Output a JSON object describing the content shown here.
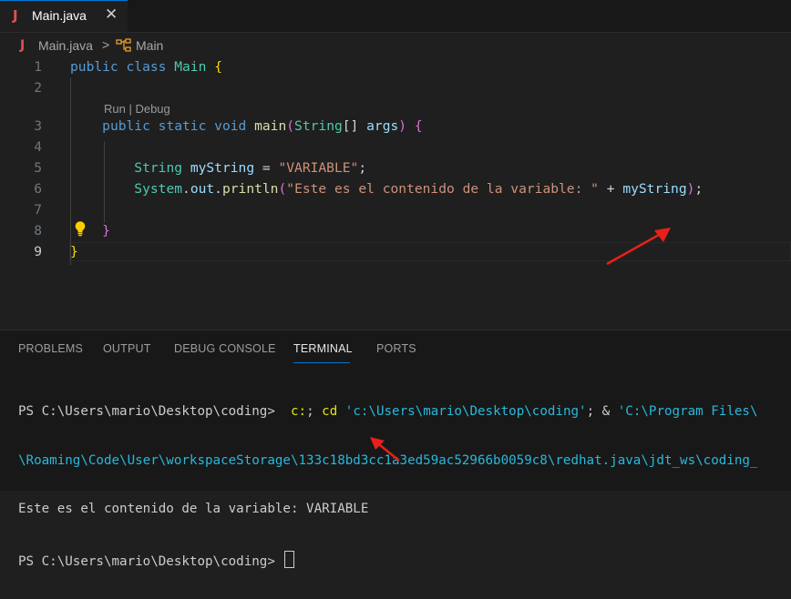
{
  "tab": {
    "icon": "java-file-icon",
    "filename": "Main.java",
    "close": "✕"
  },
  "breadcrumb": {
    "file": "Main.java",
    "separator": ">",
    "class_icon": "class-symbol-icon",
    "symbol": "Main"
  },
  "editor": {
    "line_numbers": [
      "1",
      "2",
      "3",
      "4",
      "5",
      "6",
      "7",
      "8",
      "9"
    ],
    "codelens": "Run | Debug",
    "lines": {
      "l1": {
        "kw": "public class ",
        "name": "Main",
        "brace": "{"
      },
      "l3": {
        "kw1": "public static void ",
        "fn": "main",
        "paren_open": "(",
        "type": "String",
        "arr": "[]",
        "param": " args",
        "paren_close": ")",
        "brace": "{"
      },
      "l5": {
        "type": "String",
        "var": "myString",
        "op": " = ",
        "str": "\"VARIABLE\"",
        "semi": ";"
      },
      "l6": {
        "cls": "System",
        "dot1": ".",
        "out": "out",
        "dot2": ".",
        "fn": "println",
        "po": "(",
        "str": "\"Este es el contenido de la variable: \"",
        "plus": " + ",
        "var": "myString",
        "pc": ")",
        "semi": ";"
      },
      "l8": {
        "brace": "}"
      },
      "l9": {
        "brace": "}"
      }
    },
    "lightbulb_icon": "lightbulb-icon"
  },
  "panel": {
    "tabs": [
      "PROBLEMS",
      "OUTPUT",
      "DEBUG CONSOLE",
      "TERMINAL",
      "PORTS"
    ],
    "active_tab": "TERMINAL"
  },
  "terminal": {
    "line1_prompt": "PS C:\\Users\\mario\\Desktop\\coding> ",
    "line1_cmd1": "c:",
    "line1_sep1": "; ",
    "line1_cmd2": "cd",
    "line1_arg": " 'c:\\Users\\mario\\Desktop\\coding'",
    "line1_sep2": "; & ",
    "line1_path": "'C:\\Program Files\\",
    "line2": "\\Roaming\\Code\\User\\workspaceStorage\\133c18bd3cc1a3ed59ac52966b0059c8\\redhat.java\\jdt_ws\\coding_",
    "line3": "Este es el contenido de la variable: VARIABLE",
    "line4_prompt": "PS C:\\Users\\mario\\Desktop\\coding> "
  },
  "colors": {
    "accent": "#0078d4",
    "annotation_arrow": "#e8201a"
  }
}
